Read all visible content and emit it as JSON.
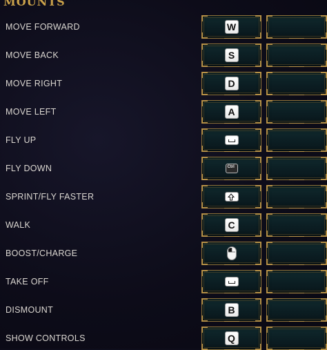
{
  "section": {
    "title": "MOUNTS"
  },
  "colors": {
    "accent_gold": "#c9a14a",
    "slot_border": "#8f733a",
    "slot_fill": "#0b1d22",
    "background": "#0d0c19"
  },
  "bindings": [
    {
      "label": "MOVE FORWARD",
      "key": "W",
      "key_icon": "key-w-icon",
      "secondary": ""
    },
    {
      "label": "MOVE BACK",
      "key": "S",
      "key_icon": "key-s-icon",
      "secondary": ""
    },
    {
      "label": "MOVE RIGHT",
      "key": "D",
      "key_icon": "key-d-icon",
      "secondary": ""
    },
    {
      "label": "MOVE LEFT",
      "key": "A",
      "key_icon": "key-a-icon",
      "secondary": ""
    },
    {
      "label": "FLY UP",
      "key": "",
      "key_icon": "spacebar-icon",
      "secondary": ""
    },
    {
      "label": "FLY DOWN",
      "key": "Ctrl",
      "key_icon": "ctrl-key-icon",
      "secondary": ""
    },
    {
      "label": "SPRINT/FLY FASTER",
      "key": "",
      "key_icon": "shift-key-icon",
      "secondary": ""
    },
    {
      "label": "WALK",
      "key": "C",
      "key_icon": "key-c-icon",
      "secondary": ""
    },
    {
      "label": "BOOST/CHARGE",
      "key": "",
      "key_icon": "left-mouse-button-icon",
      "secondary": ""
    },
    {
      "label": "TAKE OFF",
      "key": "",
      "key_icon": "spacebar-icon",
      "secondary": ""
    },
    {
      "label": "DISMOUNT",
      "key": "B",
      "key_icon": "key-b-icon",
      "secondary": ""
    },
    {
      "label": "SHOW CONTROLS",
      "key": "Q",
      "key_icon": "key-q-icon",
      "secondary": ""
    }
  ]
}
